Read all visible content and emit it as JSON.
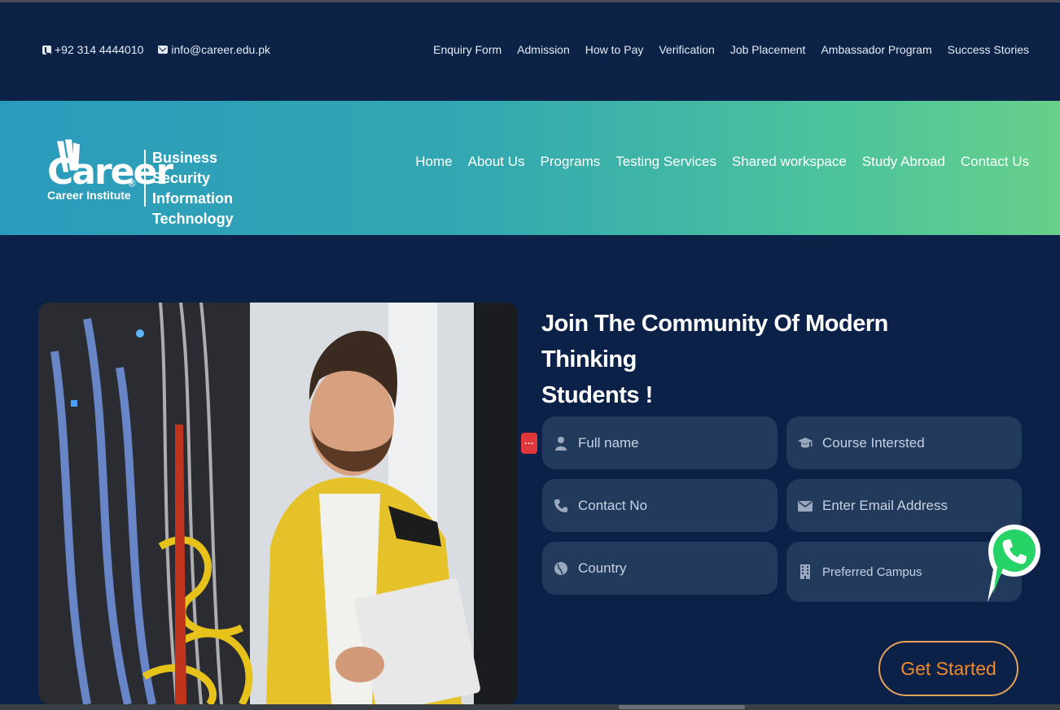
{
  "topbar": {
    "phone": "+92 314 4444010",
    "email": "info@career.edu.pk",
    "links": [
      "Enquiry Form",
      "Admission",
      "How to Pay",
      "Verification",
      "Job Placement",
      "Ambassador Program",
      "Success Stories"
    ]
  },
  "logo": {
    "wordmark": "Career",
    "subtitle": "Career Institute",
    "tags": [
      "Business",
      "Security",
      "Information Technology"
    ]
  },
  "nav": [
    "Home",
    "About Us",
    "Programs",
    "Testing Services",
    "Shared workspace",
    "Study Abroad",
    "Contact Us"
  ],
  "hero": {
    "heading_line1": "Join The Community Of Modern Thinking",
    "heading_line2": "Students !"
  },
  "form": {
    "full_name": "Full name",
    "course": "Course Intersted",
    "contact": "Contact No",
    "email": "Enter Email Address",
    "country": "Country",
    "campus": "Preferred Campus",
    "submit": "Get Started"
  },
  "colors": {
    "background": "#0c2147",
    "header_gradient_start": "#2a9bbd",
    "header_gradient_end": "#67cf8a",
    "field_bg": "#223a5c",
    "cta_border": "#e7a35a",
    "cta_text": "#f08a2d",
    "whatsapp": "#25d366"
  },
  "icons": {
    "phone": "phone-icon",
    "mail": "mail-icon",
    "user": "user-icon",
    "graduation_cap": "graduation-cap-icon",
    "telephone": "telephone-icon",
    "envelope": "envelope-icon",
    "globe": "globe-icon",
    "building": "building-icon",
    "whatsapp": "whatsapp-icon",
    "more": "more-dots-icon"
  }
}
